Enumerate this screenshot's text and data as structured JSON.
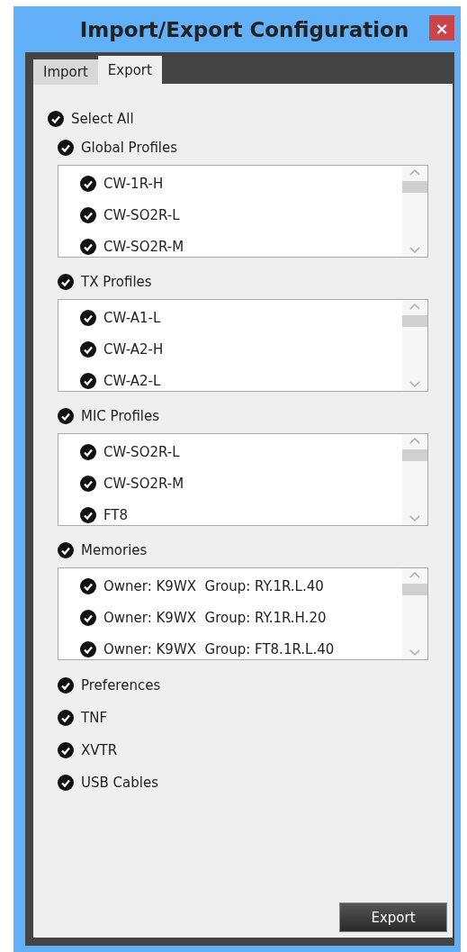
{
  "window": {
    "title": "Import/Export Configuration",
    "close": "×"
  },
  "tabs": [
    {
      "label": "Import",
      "selected": false
    },
    {
      "label": "Export",
      "selected": true
    }
  ],
  "select_all": {
    "label": "Select All",
    "checked": true
  },
  "sections": [
    {
      "kind": "list",
      "label": "Global Profiles",
      "checked": true,
      "items": [
        {
          "label": "CW-1R-H",
          "checked": true
        },
        {
          "label": "CW-SO2R-L",
          "checked": true
        },
        {
          "label": "CW-SO2R-M",
          "checked": true
        }
      ]
    },
    {
      "kind": "list",
      "label": "TX Profiles",
      "checked": true,
      "items": [
        {
          "label": "CW-A1-L",
          "checked": true
        },
        {
          "label": "CW-A2-H",
          "checked": true
        },
        {
          "label": "CW-A2-L",
          "checked": true
        }
      ]
    },
    {
      "kind": "list",
      "label": "MIC Profiles",
      "checked": true,
      "items": [
        {
          "label": "CW-SO2R-L",
          "checked": true
        },
        {
          "label": "CW-SO2R-M",
          "checked": true
        },
        {
          "label": "FT8",
          "checked": true
        }
      ]
    },
    {
      "kind": "list",
      "label": "Memories",
      "checked": true,
      "items": [
        {
          "label": "Owner: K9WX  Group: RY.1R.L.40",
          "checked": true
        },
        {
          "label": "Owner: K9WX  Group: RY.1R.H.20",
          "checked": true
        },
        {
          "label": "Owner: K9WX  Group: FT8.1R.L.40",
          "checked": true
        }
      ]
    },
    {
      "kind": "option",
      "label": "Preferences",
      "checked": true
    },
    {
      "kind": "option",
      "label": "TNF",
      "checked": true
    },
    {
      "kind": "option",
      "label": "XVTR",
      "checked": true
    },
    {
      "kind": "option",
      "label": "USB Cables",
      "checked": true
    }
  ],
  "buttons": [
    {
      "label": "Export"
    }
  ]
}
